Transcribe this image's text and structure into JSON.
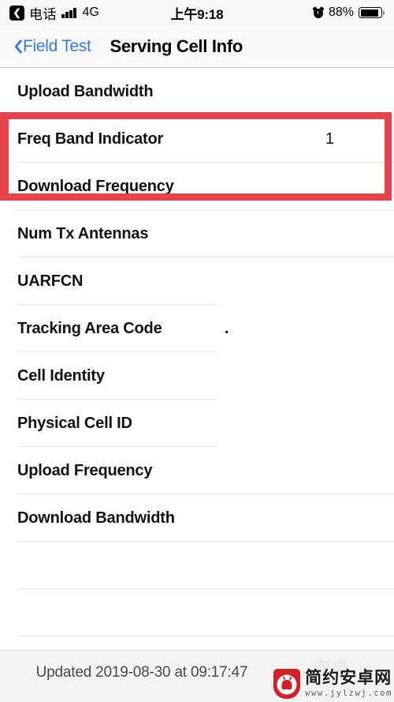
{
  "status_bar": {
    "back_chip_icon": "chevron-left-icon",
    "carrier": "电话",
    "signal_icon": "signal-bars-icon",
    "network": "4G",
    "time": "上午9:18",
    "alarm_icon": "alarm-clock-icon",
    "battery_percent": "88%",
    "battery_icon": "battery-full-icon",
    "battery_level": 88
  },
  "nav_bar": {
    "back_icon": "chevron-left-icon",
    "back_label": "Field Test",
    "title": "Serving Cell Info"
  },
  "list": {
    "rows": [
      {
        "label": "Upload Bandwidth",
        "value": "",
        "sep": "full"
      },
      {
        "label": "Freq Band Indicator",
        "value": "1",
        "sep": "full"
      },
      {
        "label": "Download Frequency",
        "value": "",
        "sep": "full"
      },
      {
        "label": "Num Tx Antennas",
        "value": "",
        "sep": "full"
      },
      {
        "label": "UARFCN",
        "value": "",
        "sep": "inset"
      },
      {
        "label": "Tracking Area Code",
        "value": ".",
        "sep": "inset"
      },
      {
        "label": "Cell Identity",
        "value": "",
        "sep": "inset"
      },
      {
        "label": "Physical Cell ID",
        "value": "",
        "sep": "inset"
      },
      {
        "label": "Upload Frequency",
        "value": "",
        "sep": "full"
      },
      {
        "label": "Download Bandwidth",
        "value": "",
        "sep": "full"
      },
      {
        "label": "",
        "value": "",
        "sep": "full"
      },
      {
        "label": "",
        "value": "",
        "sep": "full"
      }
    ]
  },
  "highlight": {
    "color": "#e8434a",
    "covers": [
      "Freq Band Indicator",
      "Download Frequency"
    ]
  },
  "footer": {
    "updated_text": "Updated 2019-08-30 at 09:17:47"
  },
  "watermark": {
    "logo_icon": "android-shield-icon",
    "name": "简约安卓网",
    "url": "www.jylzwj.com",
    "ghost": "安卓"
  }
}
